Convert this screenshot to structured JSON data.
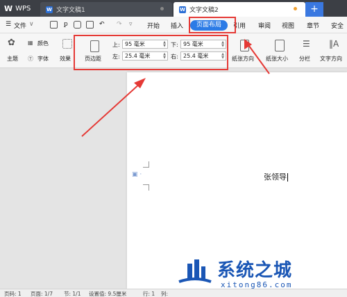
{
  "app": {
    "logo_text": "WPS"
  },
  "tabs": [
    {
      "label": "文字文稿1"
    },
    {
      "label": "文字文稿2"
    }
  ],
  "new_tab": "+",
  "menubar": {
    "file": "文件",
    "items": [
      "开始",
      "插入",
      "页面布局",
      "引用",
      "审阅",
      "视图",
      "章节",
      "安全"
    ],
    "active": "页面布局"
  },
  "ribbon": {
    "theme": "主题",
    "colors": "颜色",
    "font": "字体",
    "effect": "效果",
    "margins": "页边距",
    "top_label": "上:",
    "top_value": "95 毫米",
    "bottom_label": "下:",
    "bottom_value": "95 毫米",
    "left_label": "左:",
    "left_value": "25.4 毫米",
    "right_label": "右:",
    "right_value": "25.4 毫米",
    "orientation": "纸张方向",
    "size": "纸张大小",
    "columns": "分栏",
    "text_direction": "文字方向"
  },
  "document": {
    "text": "张领导"
  },
  "statusbar": {
    "page_code": "页码: 1",
    "pages": "页面: 1/7",
    "section": "节: 1/1",
    "setting": "设置值: 9.5厘米",
    "line": "行: 1",
    "col": "列:"
  },
  "watermark": {
    "title": "系统之城",
    "url": "xitong86.com"
  },
  "colors": {
    "accent": "#2b7be6",
    "annotation": "#e53935",
    "watermark": "#1a56b5"
  }
}
